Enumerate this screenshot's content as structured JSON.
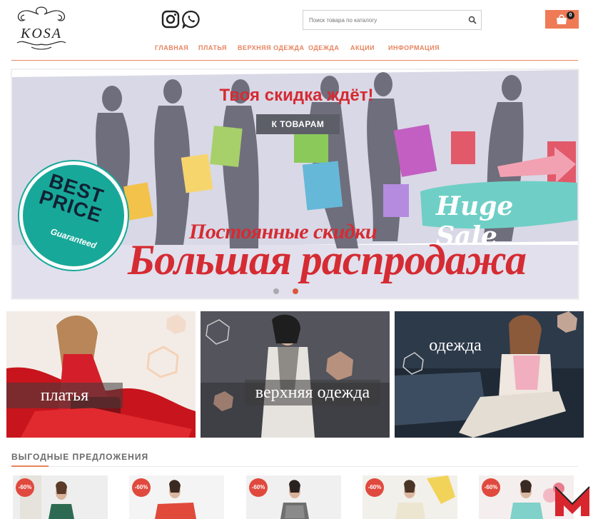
{
  "header": {
    "logo_text": "KOSA",
    "search_placeholder": "Поиск товара по каталогу",
    "cart_count": "0"
  },
  "nav": [
    {
      "label": "ГЛАВНАЯ"
    },
    {
      "label": "ПЛАТЬЯ"
    },
    {
      "label": "ВЕРХНЯЯ ОДЕЖДА"
    },
    {
      "label": "ОДЕЖДА"
    },
    {
      "label": "АКЦИИ"
    },
    {
      "label": "ИНФОРМАЦИЯ"
    }
  ],
  "banner": {
    "promo": "Твоя скидка ждёт!",
    "button": "К ТОВАРАМ",
    "subtitle": "Постоянные скидки",
    "title": "Большая распродажа",
    "sale_tag": "Huge Sale",
    "badge_line1": "BEST",
    "badge_line2": "PRICE",
    "badge_sub": "Guaranteed",
    "slides": 2,
    "active_slide": 2
  },
  "categories": [
    {
      "label": "платья"
    },
    {
      "label": "верхняя одежда"
    },
    {
      "label": "одежда"
    }
  ],
  "offers": {
    "title": "ВЫГОДНЫЕ ПРЕДЛОЖЕНИЯ",
    "products": [
      {
        "discount": "-60%"
      },
      {
        "discount": "-60%"
      },
      {
        "discount": "-60%"
      },
      {
        "discount": "-60%"
      },
      {
        "discount": "-60%"
      }
    ]
  },
  "colors": {
    "accent": "#e7845f",
    "cart": "#ef7a56",
    "sale_red": "#d52b33",
    "badge_teal": "#18a89a",
    "banner_bg": "#d9d8e6"
  }
}
